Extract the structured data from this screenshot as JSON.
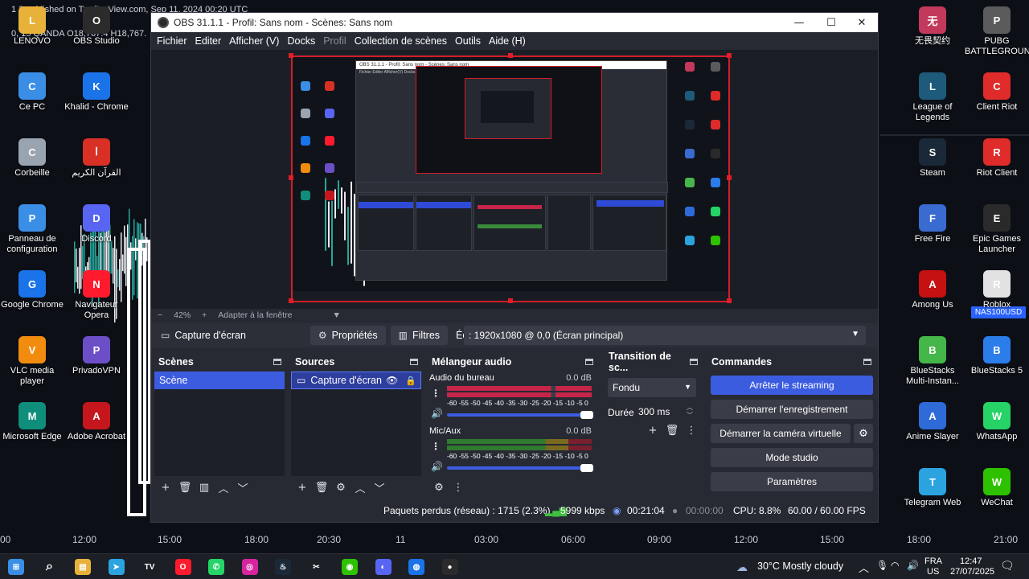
{
  "desktop": {
    "chart_top_text": "1 2 published on TradingView.com, Sep 11, 2024 00:20 UTC",
    "chart_second_text": "0, 15  QANDA  O18,767.4  H18,767.",
    "price_badge": "NAS100USD",
    "x_axis_ticks": [
      "00",
      "12:00",
      "15:00",
      "18:00",
      "20:30",
      "11",
      "03:00",
      "06:00",
      "09:00",
      "12:00",
      "15:00",
      "18:00",
      "21:00"
    ],
    "left_icons": [
      {
        "label": "LENOVO",
        "icon": "folder-icon",
        "color": "#e8b23a"
      },
      {
        "label": "OBS Studio",
        "icon": "obs-icon",
        "color": "#2b2b2b"
      },
      {
        "label": "Ce PC",
        "icon": "computer-icon",
        "color": "#3a8ee6"
      },
      {
        "label": "Khalid - Chrome",
        "icon": "chrome-icon",
        "color": "#1a73e8"
      },
      {
        "label": "Corbeille",
        "icon": "recycle-bin-icon",
        "color": "#9aa4b1"
      },
      {
        "label": "القرآن الكريم",
        "icon": "pdf-icon",
        "color": "#d93025"
      },
      {
        "label": "Panneau de configuration",
        "icon": "control-panel-icon",
        "color": "#3a8ee6"
      },
      {
        "label": "Discord",
        "icon": "discord-icon",
        "color": "#5865f2"
      },
      {
        "label": "Google Chrome",
        "icon": "chrome-icon",
        "color": "#1a73e8"
      },
      {
        "label": "Navigateur Opera",
        "icon": "opera-icon",
        "color": "#ff1b2d"
      },
      {
        "label": "VLC media player",
        "icon": "vlc-icon",
        "color": "#f28c0f"
      },
      {
        "label": "PrivadoVPN",
        "icon": "vpn-icon",
        "color": "#6c4fc7"
      },
      {
        "label": "Microsoft Edge",
        "icon": "edge-icon",
        "color": "#0f8f7b"
      },
      {
        "label": "Adobe Acrobat",
        "icon": "acrobat-icon",
        "color": "#c4161c"
      }
    ],
    "right_icons": [
      {
        "label": "无畏契约",
        "icon": "valorant-icon",
        "color": "#c2395b"
      },
      {
        "label": "PUBG BATTLEGROUN...",
        "icon": "pubg-icon",
        "color": "#5b5b5b"
      },
      {
        "label": "League of Legends",
        "icon": "lol-icon",
        "color": "#1e5b7a"
      },
      {
        "label": "Client Riot",
        "icon": "riot-icon",
        "color": "#e02b2b"
      },
      {
        "label": "Steam",
        "icon": "steam-icon",
        "color": "#1b2838"
      },
      {
        "label": "Riot Client",
        "icon": "riot-icon",
        "color": "#e02b2b"
      },
      {
        "label": "Free Fire",
        "icon": "freefire-icon",
        "color": "#3a6bd1"
      },
      {
        "label": "Epic Games Launcher",
        "icon": "epic-icon",
        "color": "#2a2a2a"
      },
      {
        "label": "Among Us",
        "icon": "amongus-icon",
        "color": "#c51111"
      },
      {
        "label": "Roblox",
        "icon": "roblox-icon",
        "color": "#e2e2e2"
      },
      {
        "label": "BlueStacks Multi-Instan...",
        "icon": "bluestacks-icon",
        "color": "#45b649"
      },
      {
        "label": "BlueStacks 5",
        "icon": "bluestacks-icon",
        "color": "#2b7de9"
      },
      {
        "label": "Anime Slayer",
        "icon": "anime-slayer-icon",
        "color": "#2f6bd8"
      },
      {
        "label": "WhatsApp",
        "icon": "whatsapp-icon",
        "color": "#25d366"
      },
      {
        "label": "Telegram Web",
        "icon": "telegram-icon",
        "color": "#2aa3df"
      },
      {
        "label": "WeChat",
        "icon": "wechat-icon",
        "color": "#2dc100"
      }
    ]
  },
  "obs": {
    "title": "OBS 31.1.1 - Profil: Sans nom - Scènes: Sans nom",
    "menu": [
      "Fichier",
      "Editer",
      "Afficher (V)",
      "Docks",
      "Profil",
      "Collection de scènes",
      "Outils",
      "Aide (H)"
    ],
    "preview_nested_title": "OBS 31.1.1 - Profil: Sans nom - Scènes: Sans nom",
    "zoom": {
      "minus": "−",
      "value": "42%",
      "plus": "+",
      "fit": "Adapter à la fenêtre"
    },
    "source_bar": {
      "source_name": "Capture d'écran",
      "properties": "Propriétés",
      "filters": "Filtres",
      "screen_label": "Écran",
      "screen_value": ": 1920x1080 @ 0,0 (Écran principal)"
    },
    "scenes": {
      "title": "Scènes",
      "items": [
        "Scène"
      ]
    },
    "sources": {
      "title": "Sources",
      "items": [
        "Capture d'écran"
      ]
    },
    "mixer": {
      "title": "Mélangeur audio",
      "scale": "-60 -55 -50 -45 -40 -35 -30 -25 -20 -15 -10 -5 0",
      "channels": [
        {
          "name": "Audio du bureau",
          "db": "0.0 dB"
        },
        {
          "name": "Mic/Aux",
          "db": "0.0 dB"
        }
      ]
    },
    "transitions": {
      "title": "Transition de sc...",
      "selected": "Fondu",
      "duration_label": "Durée",
      "duration_value": "300 ms"
    },
    "controls": {
      "title": "Commandes",
      "stop_streaming": "Arrêter le streaming",
      "start_recording": "Démarrer l'enregistrement",
      "start_virtual_cam": "Démarrer la caméra virtuelle",
      "studio_mode": "Mode studio",
      "settings": "Paramètres"
    },
    "status": {
      "dropped": "Paquets perdus (réseau) : 1715 (2.3%)",
      "bitrate": "5999 kbps",
      "stream_time": "00:21:04",
      "rec_time": "00:00:00",
      "cpu": "CPU: 8.8%",
      "fps": "60.00 / 60.00 FPS"
    },
    "colors": {
      "accent": "#3c5ce0",
      "selection_border": "#d01f2a"
    }
  },
  "taskbar": {
    "weather": "30°C  Mostly cloudy",
    "lang": "FRA",
    "region": "US",
    "time": "12:47",
    "date": "27/07/2025",
    "icons": [
      "windows-start-icon",
      "search-icon",
      "file-explorer-icon",
      "telegram-icon",
      "tradingview-icon",
      "opera-icon",
      "whatsapp-icon",
      "instagram-icon",
      "steam-icon",
      "capcut-icon",
      "wechat-icon",
      "discord-icon",
      "chrome-icon",
      "obs-icon"
    ]
  }
}
